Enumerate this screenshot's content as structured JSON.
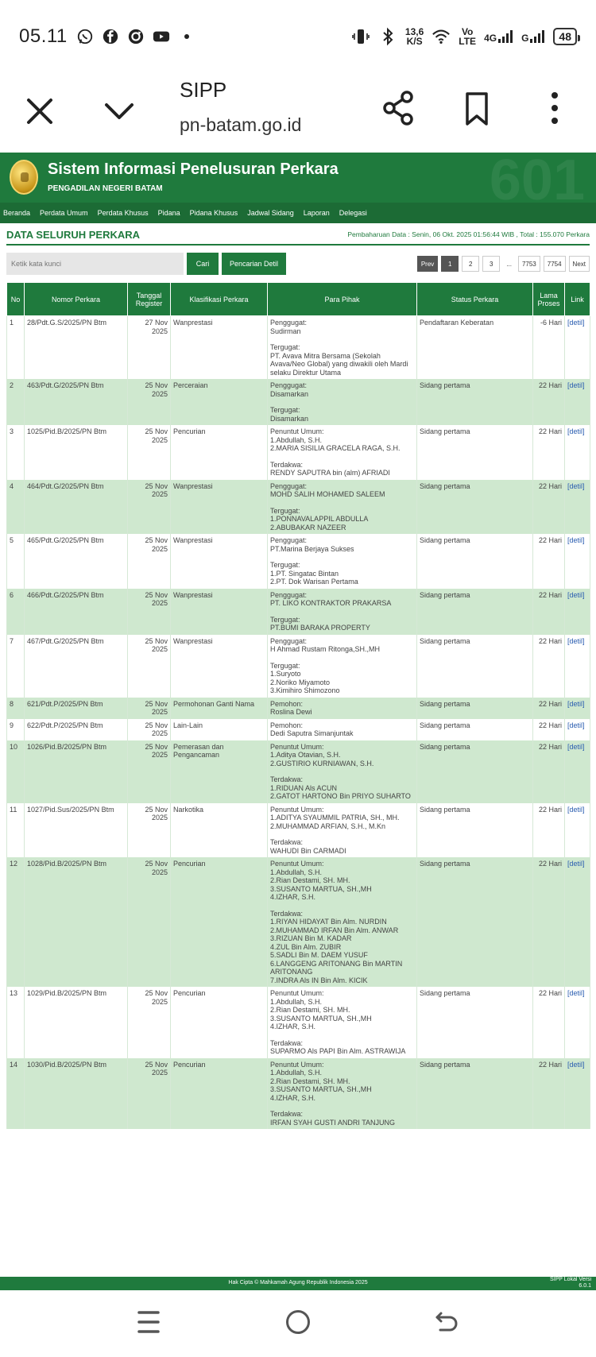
{
  "status_bar": {
    "time": "05.11",
    "left_icons": [
      "whatsapp-icon",
      "facebook-icon",
      "sync-icon",
      "youtube-icon",
      "dot-icon"
    ],
    "net_speed_value": "13,6",
    "net_speed_unit": "K/S",
    "volte_top": "Vo",
    "volte_bottom": "LTE",
    "signal_4g": "4G",
    "signal_g": "G",
    "battery": "48"
  },
  "browser": {
    "title": "SIPP",
    "url": "pn-batam.go.id"
  },
  "site": {
    "title": "Sistem Informasi Penelusuran Perkara",
    "subtitle": "PENGADILAN NEGERI BATAM",
    "watermark": "601",
    "nav": [
      "Beranda",
      "Perdata Umum",
      "Perdata Khusus",
      "Pidana",
      "Pidana Khusus",
      "Jadwal Sidang",
      "Laporan",
      "Delegasi"
    ]
  },
  "heading": "DATA SELURUH PERKARA",
  "update_text": "Pembaharuan Data : Senin, 06 Okt. 2025 01:56:44 WIB , Total : 155.070 Perkara",
  "search": {
    "placeholder": "Ketik kata kunci",
    "cari": "Cari",
    "detil": "Pencarian Detil"
  },
  "pager": [
    "Prev",
    "1",
    "2",
    "3",
    "...",
    "7753",
    "7754",
    "Next"
  ],
  "table": {
    "headers": [
      "No",
      "Nomor Perkara",
      "Tanggal Register",
      "Klasifikasi Perkara",
      "Para Pihak",
      "Status Perkara",
      "Lama Proses",
      "Link"
    ],
    "rows": [
      {
        "no": "1",
        "nomor": "28/Pdt.G.S/2025/PN Btm",
        "tanggal": "27 Nov 2025",
        "klasifikasi": "Wanprestasi",
        "pihak": [
          "Penggugat:",
          "Sudirman",
          "",
          "Tergugat:",
          "PT. Avava Mitra Bersama (Sekolah Avava/Neo Global) yang diwakili oleh Mardi selaku Direktur Utama"
        ],
        "status": "Pendaftaran Keberatan",
        "lama": "-6 Hari",
        "link": "[detil]"
      },
      {
        "no": "2",
        "nomor": "463/Pdt.G/2025/PN Btm",
        "tanggal": "25 Nov 2025",
        "klasifikasi": "Perceraian",
        "pihak": [
          "Penggugat:",
          "Disamarkan",
          "",
          "Tergugat:",
          "Disamarkan"
        ],
        "status": "Sidang pertama",
        "lama": "22 Hari",
        "link": "[detil]"
      },
      {
        "no": "3",
        "nomor": "1025/Pid.B/2025/PN Btm",
        "tanggal": "25 Nov 2025",
        "klasifikasi": "Pencurian",
        "pihak": [
          "Penuntut Umum:",
          "1.Abdullah, S.H.",
          "2.MARIA SISILIA GRACELA RAGA, S.H.",
          "",
          "Terdakwa:",
          "RENDY SAPUTRA bin (alm) AFRIADI"
        ],
        "status": "Sidang pertama",
        "lama": "22 Hari",
        "link": "[detil]"
      },
      {
        "no": "4",
        "nomor": "464/Pdt.G/2025/PN Btm",
        "tanggal": "25 Nov 2025",
        "klasifikasi": "Wanprestasi",
        "pihak": [
          "Penggugat:",
          "MOHD SALIH MOHAMED SALEEM",
          "",
          "Tergugat:",
          "1.PONNAVALAPPIL ABDULLA",
          "2.ABUBAKAR NAZEER"
        ],
        "status": "Sidang pertama",
        "lama": "22 Hari",
        "link": "[detil]"
      },
      {
        "no": "5",
        "nomor": "465/Pdt.G/2025/PN Btm",
        "tanggal": "25 Nov 2025",
        "klasifikasi": "Wanprestasi",
        "pihak": [
          "Penggugat:",
          "PT.Marina Berjaya Sukses",
          "",
          "Tergugat:",
          "1.PT. Singatac Bintan",
          "2.PT. Dok Warisan Pertama"
        ],
        "status": "Sidang pertama",
        "lama": "22 Hari",
        "link": "[detil]"
      },
      {
        "no": "6",
        "nomor": "466/Pdt.G/2025/PN Btm",
        "tanggal": "25 Nov 2025",
        "klasifikasi": "Wanprestasi",
        "pihak": [
          "Penggugat:",
          "PT. LIKO KONTRAKTOR PRAKARSA",
          "",
          "Tergugat:",
          "PT.BUMI BARAKA PROPERTY"
        ],
        "status": "Sidang pertama",
        "lama": "22 Hari",
        "link": "[detil]"
      },
      {
        "no": "7",
        "nomor": "467/Pdt.G/2025/PN Btm",
        "tanggal": "25 Nov 2025",
        "klasifikasi": "Wanprestasi",
        "pihak": [
          "Penggugat:",
          "H Ahmad Rustam Ritonga,SH.,MH",
          "",
          "Tergugat:",
          "1.Suryoto",
          "2.Noriko Miyamoto",
          "3.Kimihiro Shimozono"
        ],
        "status": "Sidang pertama",
        "lama": "22 Hari",
        "link": "[detil]"
      },
      {
        "no": "8",
        "nomor": "621/Pdt.P/2025/PN Btm",
        "tanggal": "25 Nov 2025",
        "klasifikasi": "Permohonan Ganti Nama",
        "pihak": [
          "Pemohon:",
          "Roslina Dewi"
        ],
        "status": "Sidang pertama",
        "lama": "22 Hari",
        "link": "[detil]"
      },
      {
        "no": "9",
        "nomor": "622/Pdt.P/2025/PN Btm",
        "tanggal": "25 Nov 2025",
        "klasifikasi": "Lain-Lain",
        "pihak": [
          "Pemohon:",
          "Dedi Saputra Simanjuntak"
        ],
        "status": "Sidang pertama",
        "lama": "22 Hari",
        "link": "[detil]"
      },
      {
        "no": "10",
        "nomor": "1026/Pid.B/2025/PN Btm",
        "tanggal": "25 Nov 2025",
        "klasifikasi": "Pemerasan dan Pengancaman",
        "pihak": [
          "Penuntut Umum:",
          "1.Aditya Otavian, S.H.",
          "2.GUSTIRIO KURNIAWAN, S.H.",
          "",
          "Terdakwa:",
          "1.RIDUAN Als ACUN",
          "2.GATOT HARTONO Bin PRIYO SUHARTO"
        ],
        "status": "Sidang pertama",
        "lama": "22 Hari",
        "link": "[detil]"
      },
      {
        "no": "11",
        "nomor": "1027/Pid.Sus/2025/PN Btm",
        "tanggal": "25 Nov 2025",
        "klasifikasi": "Narkotika",
        "pihak": [
          "Penuntut Umum:",
          "1.ADITYA SYAUMMIL PATRIA, SH., MH.",
          "2.MUHAMMAD ARFIAN, S.H., M.Kn",
          "",
          "Terdakwa:",
          "WAHUDI Bin CARMADI"
        ],
        "status": "Sidang pertama",
        "lama": "22 Hari",
        "link": "[detil]"
      },
      {
        "no": "12",
        "nomor": "1028/Pid.B/2025/PN Btm",
        "tanggal": "25 Nov 2025",
        "klasifikasi": "Pencurian",
        "pihak": [
          "Penuntut Umum:",
          "1.Abdullah, S.H.",
          "2.Rian Destami, SH. MH.",
          "3.SUSANTO MARTUA, SH.,MH",
          "4.IZHAR, S.H.",
          "",
          "Terdakwa:",
          "1.RIYAN HIDAYAT Bin Alm. NURDIN",
          "2.MUHAMMAD IRFAN Bin Alm. ANWAR",
          "3.RIZUAN Bin M. KADAR",
          "4.ZUL Bin Alm. ZUBIR",
          "5.SADLI Bin M. DAEM YUSUF",
          "6.LANGGENG ARITONANG Bin MARTIN ARITONANG",
          "7.INDRA Als IN Bin Alm. KICIK"
        ],
        "status": "Sidang pertama",
        "lama": "22 Hari",
        "link": "[detil]"
      },
      {
        "no": "13",
        "nomor": "1029/Pid.B/2025/PN Btm",
        "tanggal": "25 Nov 2025",
        "klasifikasi": "Pencurian",
        "pihak": [
          "Penuntut Umum:",
          "1.Abdullah, S.H.",
          "2.Rian Destami, SH. MH.",
          "3.SUSANTO MARTUA, SH.,MH",
          "4.IZHAR, S.H.",
          "",
          "Terdakwa:",
          "SUPARMO Als PAPI Bin Alm. ASTRAWIJA"
        ],
        "status": "Sidang pertama",
        "lama": "22 Hari",
        "link": "[detil]"
      },
      {
        "no": "14",
        "nomor": "1030/Pid.B/2025/PN Btm",
        "tanggal": "25 Nov 2025",
        "klasifikasi": "Pencurian",
        "pihak": [
          "Penuntut Umum:",
          "1.Abdullah, S.H.",
          "2.Rian Destami, SH. MH.",
          "3.SUSANTO MARTUA, SH.,MH",
          "4.IZHAR, S.H.",
          "",
          "Terdakwa:",
          "IRFAN SYAH GUSTI ANDRI TANJUNG"
        ],
        "status": "Sidang pertama",
        "lama": "22 Hari",
        "link": "[detil]"
      }
    ]
  },
  "footer": {
    "copyright": "Hak Cipta © Mahkamah Agung Republik Indonesia 2025",
    "version_line1": "SIPP Lokal Versi",
    "version_line2": "6.0.1"
  }
}
